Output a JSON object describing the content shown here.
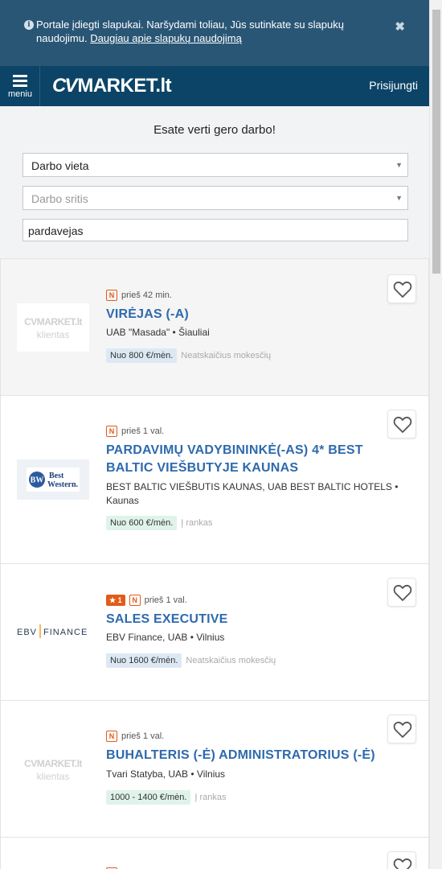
{
  "cookie": {
    "text": "Portale įdiegti slapukai. Naršydami toliau, Jūs sutinkate su slapukų naudojimu.",
    "link": "Daugiau apie slapukų naudojimą",
    "info_icon": "i",
    "close_icon": "✖"
  },
  "header": {
    "menu_label": "meniu",
    "logo_cv": "CV",
    "logo_rest": "MARKET.lt",
    "login": "Prisijungti"
  },
  "search": {
    "headline": "Esate verti gero darbo!",
    "location_value": "Darbo vieta",
    "category_placeholder": "Darbo sritis",
    "keyword_value": "pardavejas"
  },
  "placeholder_logo": {
    "brand": "CVMARKET.lt",
    "sub": "klientas"
  },
  "bw_logo": {
    "initials": "BW",
    "line1": "Best",
    "line2": "Western."
  },
  "ebv_logo": {
    "left": "EBV",
    "right": "FINANCE"
  },
  "jobs": [
    {
      "new_badge": "N",
      "time": "prieš 42 min.",
      "title": "VIRĖJAS (-A)",
      "company": "UAB \"Masada\" • Šiauliai",
      "salary": "Nuo 800 €/mėn.",
      "salary_note": "Neatskaičius mokesčių"
    },
    {
      "new_badge": "N",
      "time": "prieš 1 val.",
      "title": "PARDAVIMŲ VADYBININKĖ(-AS) 4* BEST BALTIC VIEŠBUTYJE KAUNAS",
      "company": "BEST BALTIC VIEŠBUTIS KAUNAS, UAB BEST BALTIC HOTELS • Kaunas",
      "salary": "Nuo 600 €/mėn.",
      "salary_note": "Į rankas"
    },
    {
      "star_badge": "★ 1",
      "new_badge": "N",
      "time": "prieš 1 val.",
      "title": "SALES EXECUTIVE",
      "company": "EBV Finance, UAB • Vilnius",
      "salary": "Nuo 1600 €/mėn.",
      "salary_note": "Neatskaičius mokesčių"
    },
    {
      "new_badge": "N",
      "time": "prieš 1 val.",
      "title": "BUHALTERIS (-Ė) ADMINISTRATORIUS (-Ė)",
      "company": "Tvari Statyba, UAB • Vilnius",
      "salary": "1000 - 1400 €/mėn.",
      "salary_note": "Į rankas"
    }
  ],
  "colors": {
    "header": "#0c4467",
    "cookie": "#2a5676",
    "title": "#2e6aad",
    "accent": "#e15b1b"
  }
}
